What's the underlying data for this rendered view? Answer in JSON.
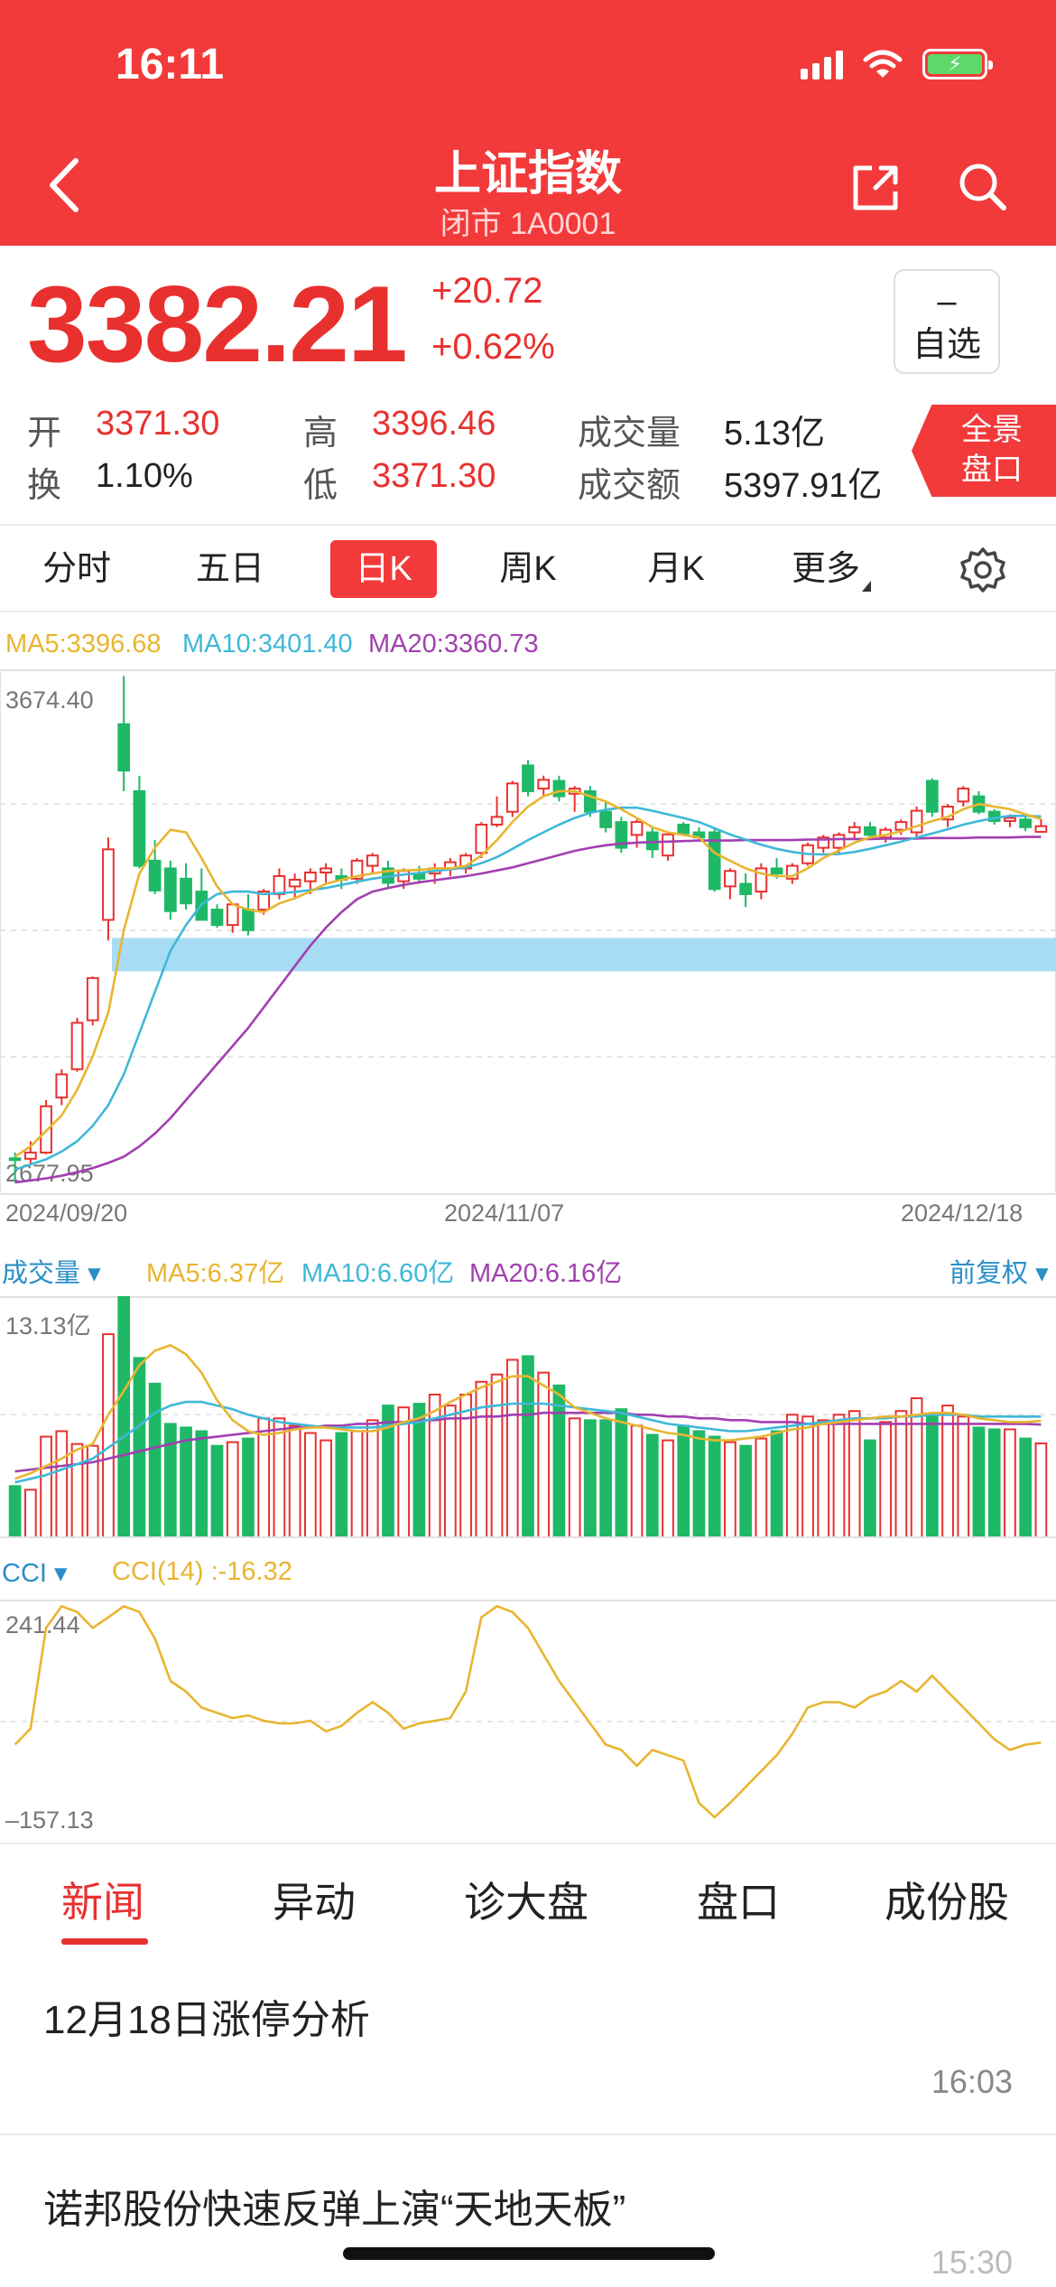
{
  "status_bar": {
    "time": "16:11"
  },
  "header": {
    "title": "上证指数",
    "subtitle": "闭市 1A0001"
  },
  "quote": {
    "price": "3382.21",
    "change": "+20.72",
    "change_pct": "+0.62%",
    "fav_symbol": "–",
    "fav_label": "自选",
    "stats": [
      {
        "label": "开",
        "value": "3371.30"
      },
      {
        "label": "高",
        "value": "3396.46"
      },
      {
        "label": "成交量",
        "value": "5.13亿"
      },
      {
        "label": "换",
        "value": "1.10%"
      },
      {
        "label": "低",
        "value": "3371.30"
      },
      {
        "label": "成交额",
        "value": "5397.91亿"
      }
    ],
    "panorama_label_1": "全景",
    "panorama_label_2": "盘口"
  },
  "period_tabs": [
    "分时",
    "五日",
    "日K",
    "周K",
    "月K",
    "更多"
  ],
  "active_period": "日K",
  "colors": {
    "up": "#e8312f",
    "down": "#1fb866",
    "ma5": "#e9b530",
    "ma10": "#3fb8d8",
    "ma20": "#a23fb0",
    "support_band": "#a8dcf5"
  },
  "chart_data": [
    {
      "type": "candlestick",
      "indicators": {
        "ma5": "MA5:3396.68",
        "ma10": "MA10:3401.40",
        "ma20": "MA20:3360.73"
      },
      "y_max_label": "3674.40",
      "y_min_label": "2677.95",
      "ylim": [
        2677.95,
        3674.4
      ],
      "x_labels": [
        "2024/09/20",
        "2024/11/07",
        "2024/12/18"
      ],
      "ohlc": [
        [
          2737,
          2748,
          2690,
          2736
        ],
        [
          2736,
          2770,
          2725,
          2748
        ],
        [
          2748,
          2850,
          2745,
          2838
        ],
        [
          2855,
          2910,
          2840,
          2900
        ],
        [
          2910,
          3010,
          2905,
          3000
        ],
        [
          3005,
          3090,
          2995,
          3087
        ],
        [
          3200,
          3360,
          3160,
          3337
        ],
        [
          3580,
          3674,
          3450,
          3490
        ],
        [
          3450,
          3480,
          3300,
          3305
        ],
        [
          3315,
          3355,
          3250,
          3257
        ],
        [
          3300,
          3315,
          3200,
          3217
        ],
        [
          3280,
          3310,
          3220,
          3232
        ],
        [
          3255,
          3300,
          3200,
          3200
        ],
        [
          3220,
          3230,
          3185,
          3190
        ],
        [
          3190,
          3230,
          3175,
          3230
        ],
        [
          3220,
          3250,
          3170,
          3180
        ],
        [
          3220,
          3260,
          3210,
          3255
        ],
        [
          3250,
          3300,
          3240,
          3285
        ],
        [
          3265,
          3290,
          3240,
          3278
        ],
        [
          3275,
          3300,
          3250,
          3292
        ],
        [
          3292,
          3310,
          3270,
          3300
        ],
        [
          3285,
          3300,
          3260,
          3278
        ],
        [
          3280,
          3320,
          3270,
          3315
        ],
        [
          3305,
          3330,
          3290,
          3325
        ],
        [
          3300,
          3315,
          3260,
          3272
        ],
        [
          3275,
          3300,
          3260,
          3295
        ],
        [
          3290,
          3305,
          3270,
          3280
        ],
        [
          3290,
          3310,
          3270,
          3300
        ],
        [
          3300,
          3320,
          3285,
          3312
        ],
        [
          3300,
          3330,
          3290,
          3325
        ],
        [
          3330,
          3390,
          3320,
          3385
        ],
        [
          3385,
          3440,
          3380,
          3400
        ],
        [
          3410,
          3470,
          3400,
          3465
        ],
        [
          3500,
          3510,
          3440,
          3450
        ],
        [
          3455,
          3480,
          3440,
          3472
        ],
        [
          3470,
          3480,
          3430,
          3440
        ],
        [
          3445,
          3460,
          3410,
          3455
        ],
        [
          3450,
          3460,
          3400,
          3410
        ],
        [
          3410,
          3430,
          3370,
          3380
        ],
        [
          3390,
          3400,
          3330,
          3340
        ],
        [
          3365,
          3395,
          3340,
          3390
        ],
        [
          3370,
          3380,
          3320,
          3337
        ],
        [
          3325,
          3370,
          3315,
          3366
        ],
        [
          3385,
          3390,
          3365,
          3368
        ],
        [
          3370,
          3380,
          3355,
          3360
        ],
        [
          3370,
          3380,
          3255,
          3260
        ],
        [
          3265,
          3300,
          3240,
          3295
        ],
        [
          3270,
          3290,
          3225,
          3250
        ],
        [
          3255,
          3310,
          3240,
          3300
        ],
        [
          3300,
          3320,
          3280,
          3290
        ],
        [
          3280,
          3310,
          3270,
          3305
        ],
        [
          3310,
          3350,
          3305,
          3345
        ],
        [
          3340,
          3365,
          3330,
          3360
        ],
        [
          3340,
          3370,
          3330,
          3365
        ],
        [
          3370,
          3390,
          3355,
          3380
        ],
        [
          3380,
          3390,
          3355,
          3365
        ],
        [
          3360,
          3380,
          3350,
          3375
        ],
        [
          3375,
          3395,
          3365,
          3390
        ],
        [
          3370,
          3420,
          3360,
          3412
        ],
        [
          3470,
          3475,
          3400,
          3410
        ],
        [
          3395,
          3425,
          3380,
          3420
        ],
        [
          3430,
          3460,
          3420,
          3455
        ],
        [
          3440,
          3450,
          3405,
          3410
        ],
        [
          3410,
          3415,
          3385,
          3392
        ],
        [
          3392,
          3405,
          3380,
          3398
        ],
        [
          3395,
          3405,
          3372,
          3380
        ],
        [
          3371,
          3396,
          3371,
          3382
        ]
      ],
      "ma5": [
        2740,
        2760,
        2790,
        2820,
        2870,
        2935,
        3020,
        3180,
        3290,
        3340,
        3375,
        3370,
        3320,
        3265,
        3230,
        3220,
        3215,
        3232,
        3242,
        3255,
        3270,
        3278,
        3285,
        3290,
        3295,
        3296,
        3297,
        3300,
        3300,
        3305,
        3325,
        3355,
        3390,
        3420,
        3440,
        3450,
        3450,
        3440,
        3430,
        3415,
        3398,
        3380,
        3370,
        3365,
        3360,
        3330,
        3315,
        3300,
        3290,
        3285,
        3285,
        3300,
        3320,
        3335,
        3350,
        3360,
        3365,
        3372,
        3382,
        3392,
        3400,
        3415,
        3425,
        3420,
        3415,
        3405,
        3396
      ],
      "ma10": [
        2715,
        2725,
        2735,
        2750,
        2770,
        2800,
        2840,
        2900,
        2980,
        3060,
        3140,
        3190,
        3230,
        3250,
        3255,
        3255,
        3250,
        3252,
        3254,
        3258,
        3262,
        3268,
        3274,
        3280,
        3284,
        3288,
        3291,
        3295,
        3298,
        3302,
        3310,
        3322,
        3338,
        3355,
        3370,
        3385,
        3398,
        3408,
        3414,
        3418,
        3418,
        3412,
        3405,
        3398,
        3390,
        3378,
        3366,
        3356,
        3346,
        3338,
        3332,
        3328,
        3327,
        3328,
        3332,
        3338,
        3345,
        3352,
        3360,
        3368,
        3376,
        3385,
        3392,
        3398,
        3402,
        3402,
        3401
      ],
      "ma20": [
        2690,
        2694,
        2698,
        2703,
        2710,
        2718,
        2728,
        2740,
        2760,
        2785,
        2815,
        2850,
        2885,
        2920,
        2955,
        2990,
        3030,
        3070,
        3110,
        3150,
        3185,
        3215,
        3240,
        3255,
        3262,
        3268,
        3273,
        3277,
        3281,
        3285,
        3290,
        3296,
        3302,
        3310,
        3318,
        3326,
        3334,
        3340,
        3345,
        3348,
        3350,
        3351,
        3352,
        3353,
        3354,
        3354,
        3354,
        3355,
        3355,
        3355,
        3355,
        3356,
        3356,
        3357,
        3357,
        3357,
        3358,
        3358,
        3358,
        3359,
        3359,
        3359,
        3360,
        3360,
        3360,
        3361,
        3361
      ],
      "support_band": [
        3100,
        3165
      ]
    },
    {
      "type": "bar",
      "title": "成交量",
      "indicators": {
        "ma5": "MA5:6.37亿",
        "ma10": "MA10:6.60亿",
        "ma20": "MA20:6.16亿"
      },
      "right_label": "前复权",
      "y_max_label": "13.13亿",
      "ylim": [
        0,
        13.13
      ],
      "values": [
        2.8,
        2.6,
        5.5,
        5.8,
        5.1,
        5.0,
        11.1,
        13.13,
        9.8,
        8.4,
        6.2,
        6.0,
        5.8,
        5.0,
        5.2,
        5.4,
        6.5,
        6.5,
        6.1,
        5.7,
        5.3,
        5.7,
        5.8,
        6.4,
        7.2,
        7.1,
        7.3,
        7.8,
        7.2,
        7.8,
        8.5,
        8.9,
        9.7,
        9.9,
        9.0,
        8.3,
        6.5,
        6.4,
        6.4,
        7.0,
        6.1,
        5.6,
        5.3,
        6.1,
        5.8,
        5.5,
        5.2,
        5.0,
        5.4,
        5.8,
        6.7,
        6.6,
        6.4,
        6.7,
        6.9,
        5.3,
        6.3,
        6.9,
        7.6,
        6.6,
        7.2,
        6.6,
        6.0,
        5.9,
        5.9,
        5.4,
        5.13
      ],
      "ma5": [
        3.2,
        3.5,
        3.9,
        4.3,
        4.8,
        5.1,
        6.7,
        8.0,
        9.4,
        10.2,
        10.5,
        10.0,
        9.0,
        7.5,
        6.4,
        5.8,
        5.6,
        5.7,
        5.9,
        6.0,
        6.0,
        5.9,
        5.8,
        5.8,
        6.0,
        6.3,
        6.5,
        6.9,
        7.4,
        7.8,
        8.2,
        8.5,
        8.8,
        8.8,
        8.3,
        7.8,
        7.1,
        6.8,
        6.5,
        6.3,
        6.1,
        5.9,
        5.7,
        5.6,
        5.4,
        5.3,
        5.3,
        5.4,
        5.5,
        5.7,
        5.9,
        6.0,
        6.2,
        6.3,
        6.4,
        6.5,
        6.6,
        6.6,
        6.7,
        6.8,
        6.8,
        6.7,
        6.5,
        6.4,
        6.3,
        6.3,
        6.37
      ],
      "ma10": [
        3.0,
        3.2,
        3.4,
        3.7,
        4.0,
        4.3,
        4.9,
        5.5,
        6.1,
        6.8,
        7.2,
        7.4,
        7.4,
        7.2,
        7.0,
        6.7,
        6.5,
        6.3,
        6.2,
        6.1,
        6.0,
        6.0,
        6.0,
        6.0,
        6.1,
        6.2,
        6.3,
        6.5,
        6.7,
        6.9,
        7.1,
        7.2,
        7.3,
        7.3,
        7.3,
        7.2,
        7.1,
        7.0,
        6.9,
        6.8,
        6.6,
        6.4,
        6.2,
        6.1,
        6.0,
        5.9,
        5.8,
        5.8,
        5.9,
        6.0,
        6.1,
        6.2,
        6.3,
        6.4,
        6.5,
        6.5,
        6.5,
        6.6,
        6.6,
        6.7,
        6.7,
        6.7,
        6.6,
        6.6,
        6.6,
        6.6,
        6.6
      ],
      "ma20": [
        3.6,
        3.7,
        3.8,
        3.9,
        4.0,
        4.1,
        4.3,
        4.5,
        4.7,
        4.9,
        5.1,
        5.3,
        5.4,
        5.5,
        5.6,
        5.7,
        5.8,
        5.9,
        6.0,
        6.0,
        6.1,
        6.1,
        6.2,
        6.2,
        6.3,
        6.3,
        6.4,
        6.4,
        6.5,
        6.5,
        6.6,
        6.6,
        6.7,
        6.7,
        6.8,
        6.8,
        6.8,
        6.8,
        6.8,
        6.8,
        6.7,
        6.7,
        6.6,
        6.6,
        6.5,
        6.5,
        6.4,
        6.4,
        6.3,
        6.3,
        6.3,
        6.2,
        6.2,
        6.2,
        6.2,
        6.2,
        6.2,
        6.2,
        6.2,
        6.2,
        6.2,
        6.2,
        6.2,
        6.2,
        6.2,
        6.2,
        6.16
      ]
    },
    {
      "type": "line",
      "title": "CCI",
      "indicator": "CCI(14)  :-16.32",
      "y_max_label": "241.44",
      "y_min_label": "–157.13",
      "ylim": [
        -157.13,
        241.44
      ],
      "values": [
        -20,
        10,
        200,
        241,
        230,
        200,
        220,
        241,
        230,
        180,
        100,
        80,
        50,
        40,
        30,
        35,
        25,
        20,
        20,
        25,
        5,
        15,
        40,
        60,
        40,
        10,
        20,
        25,
        30,
        80,
        220,
        241,
        230,
        200,
        150,
        100,
        60,
        20,
        -20,
        -30,
        -60,
        -30,
        -40,
        -50,
        -130,
        -157,
        -130,
        -100,
        -70,
        -40,
        0,
        50,
        60,
        60,
        50,
        70,
        80,
        100,
        80,
        110,
        80,
        50,
        20,
        -10,
        -30,
        -20,
        -16.32
      ]
    }
  ],
  "bottom_tabs": [
    "新闻",
    "异动",
    "诊大盘",
    "盘口",
    "成份股"
  ],
  "news": [
    {
      "title": "12月18日涨停分析",
      "time": "16:03"
    },
    {
      "title": "诺邦股份快速反弹上演“天地天板”",
      "time": "15:30"
    }
  ]
}
